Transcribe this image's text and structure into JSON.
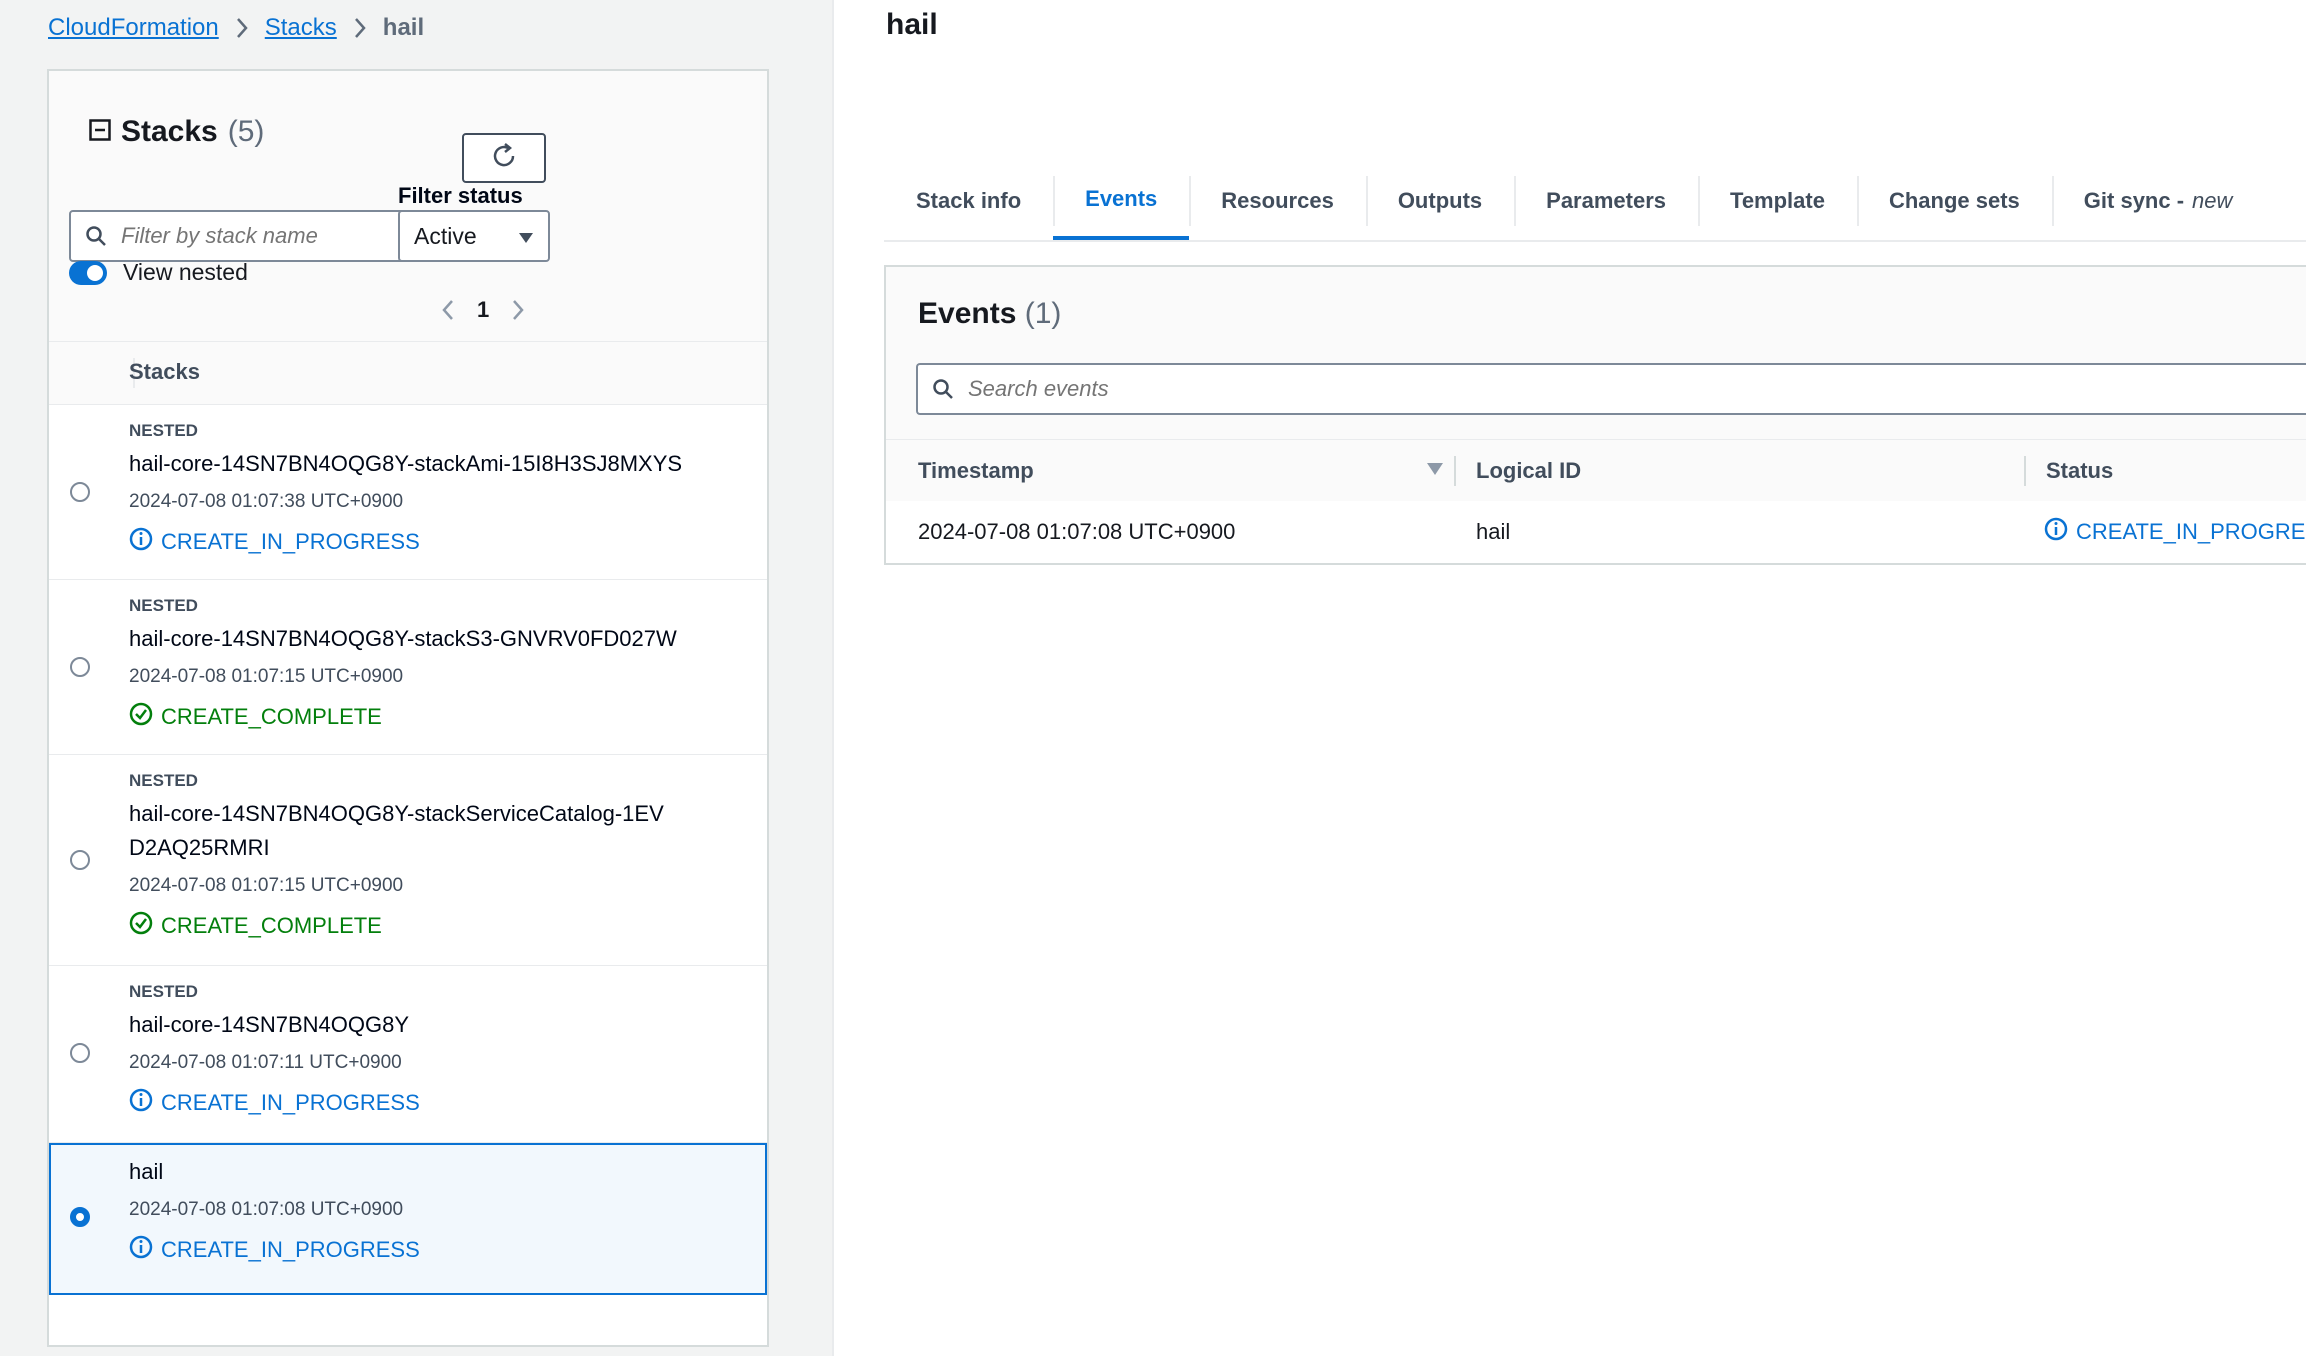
{
  "breadcrumb": {
    "items": [
      {
        "label": "CloudFormation"
      },
      {
        "label": "Stacks"
      }
    ],
    "current": "hail"
  },
  "stacks_panel": {
    "title": "Stacks",
    "count": "(5)",
    "search_placeholder": "Filter by stack name",
    "filter_label": "Filter status",
    "filter_value": "Active",
    "view_nested_label": "View nested",
    "page": "1",
    "column_header": "Stacks",
    "items": [
      {
        "tag": "NESTED",
        "name": "hail-core-14SN7BN4OQG8Y-stackAmi-15I8H3SJ8MXYS",
        "time": "2024-07-08 01:07:38 UTC+0900",
        "status": "CREATE_IN_PROGRESS"
      },
      {
        "tag": "NESTED",
        "name": "hail-core-14SN7BN4OQG8Y-stackS3-GNVRV0FD027W",
        "time": "2024-07-08 01:07:15 UTC+0900",
        "status": "CREATE_COMPLETE"
      },
      {
        "tag": "NESTED",
        "name": "hail-core-14SN7BN4OQG8Y-stackServiceCatalog-1EVD2AQ25RMRI",
        "time": "2024-07-08 01:07:15 UTC+0900",
        "status": "CREATE_COMPLETE"
      },
      {
        "tag": "NESTED",
        "name": "hail-core-14SN7BN4OQG8Y",
        "time": "2024-07-08 01:07:11 UTC+0900",
        "status": "CREATE_IN_PROGRESS"
      },
      {
        "tag": "",
        "name": "hail",
        "time": "2024-07-08 01:07:08 UTC+0900",
        "status": "CREATE_IN_PROGRESS"
      }
    ]
  },
  "detail": {
    "title": "hail",
    "tabs": [
      {
        "label": "Stack info"
      },
      {
        "label": "Events"
      },
      {
        "label": "Resources"
      },
      {
        "label": "Outputs"
      },
      {
        "label": "Parameters"
      },
      {
        "label": "Template"
      },
      {
        "label": "Change sets"
      },
      {
        "label": "Git sync -",
        "flag": "new"
      }
    ],
    "events": {
      "title": "Events",
      "count": "(1)",
      "search_placeholder": "Search events",
      "columns": {
        "timestamp": "Timestamp",
        "logical_id": "Logical ID",
        "status": "Status"
      },
      "rows": [
        {
          "timestamp": "2024-07-08 01:07:08 UTC+0900",
          "logical_id": "hail",
          "status": "CREATE_IN_PROGRESS"
        }
      ]
    }
  },
  "colors": {
    "link": "#0972d3",
    "success": "#037f0c",
    "border": "#d5dbdb",
    "panel_bg": "#f2f3f3"
  },
  "icons": {
    "chevron": "chevron-right-icon",
    "refresh": "refresh-icon",
    "search": "search-icon",
    "collapse": "collapse-icon",
    "info": "info-icon",
    "success": "check-circle-icon",
    "sort": "sort-down-icon",
    "splitter": "drag-handle-icon"
  }
}
